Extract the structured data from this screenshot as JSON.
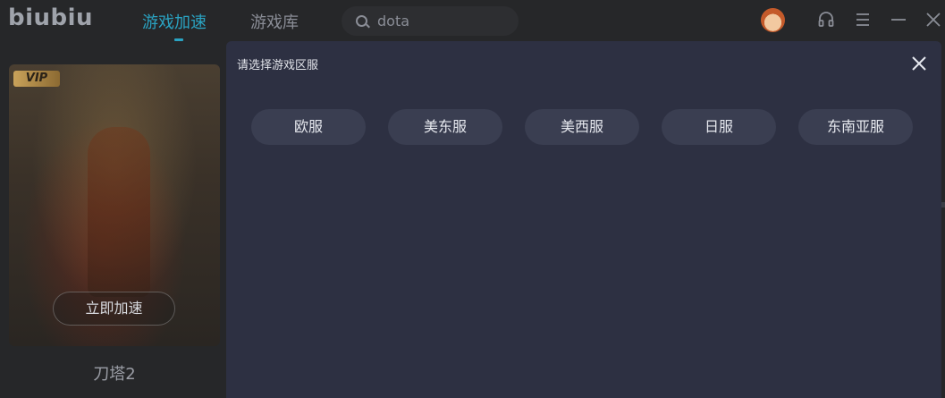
{
  "app": {
    "logo": "biubiu"
  },
  "nav": {
    "tabs": [
      {
        "label": "游戏加速"
      },
      {
        "label": "游戏库"
      }
    ]
  },
  "search": {
    "value": "dota"
  },
  "icons": {
    "search": "search-icon",
    "avatar": "avatar",
    "headset": "headset-icon",
    "menu": "menu-icon",
    "minimize": "minimize-icon",
    "close": "close-icon"
  },
  "game_card": {
    "badge": "VIP",
    "button": "立即加速",
    "name": "刀塔2"
  },
  "modal": {
    "title": "请选择游戏区服",
    "regions": [
      "欧服",
      "美东服",
      "美西服",
      "日服",
      "东南亚服"
    ]
  },
  "colors": {
    "accent": "#2aa3c2",
    "modal_bg": "#2d3042",
    "button_bg": "#3a3e51",
    "app_bg": "#262729"
  }
}
